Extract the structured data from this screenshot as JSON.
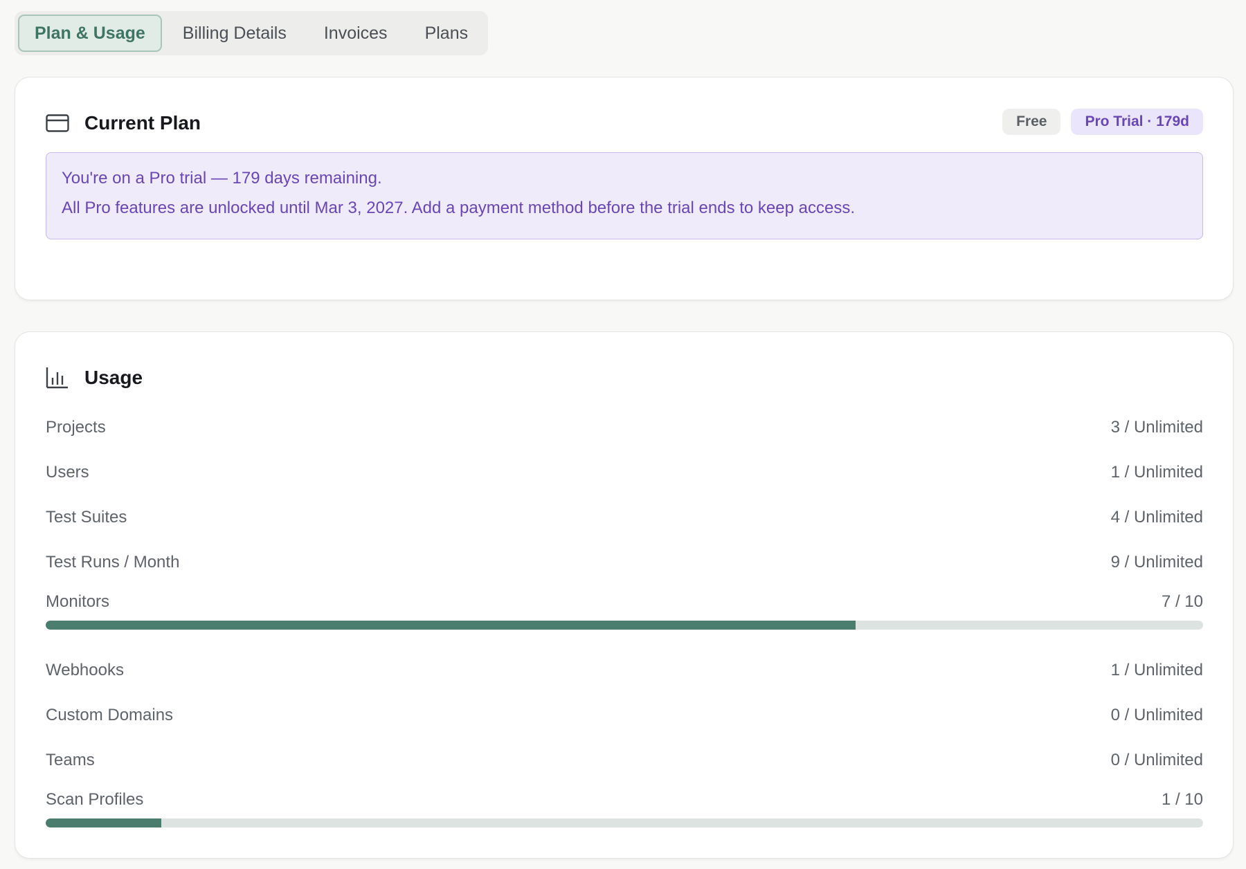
{
  "tabs": [
    {
      "label": "Plan & Usage",
      "active": true
    },
    {
      "label": "Billing Details",
      "active": false
    },
    {
      "label": "Invoices",
      "active": false
    },
    {
      "label": "Plans",
      "active": false
    }
  ],
  "current_plan": {
    "title": "Current Plan",
    "icon": "credit-card-icon",
    "badges": {
      "free": "Free",
      "trial": "Pro Trial · 179d"
    },
    "notice": {
      "title": "You're on a Pro trial — 179 days remaining.",
      "body": "All Pro features are unlocked until Mar 3, 2027. Add a payment method before the trial ends to keep access."
    }
  },
  "usage": {
    "title": "Usage",
    "icon": "bar-chart-icon",
    "rows": [
      {
        "label": "Projects",
        "value": "3 / Unlimited"
      },
      {
        "label": "Users",
        "value": "1 / Unlimited"
      },
      {
        "label": "Test Suites",
        "value": "4 / Unlimited"
      },
      {
        "label": "Test Runs / Month",
        "value": "9 / Unlimited"
      },
      {
        "label": "Monitors",
        "value": "7 / 10",
        "progress": 0.7
      },
      {
        "label": "Webhooks",
        "value": "1 / Unlimited"
      },
      {
        "label": "Custom Domains",
        "value": "0 / Unlimited"
      },
      {
        "label": "Teams",
        "value": "0 / Unlimited"
      },
      {
        "label": "Scan Profiles",
        "value": "1 / 10",
        "progress": 0.1
      }
    ]
  },
  "colors": {
    "accent": "#4a7d6e",
    "trial_purple": "#6a45b8",
    "notice_bg": "#efebfa"
  }
}
